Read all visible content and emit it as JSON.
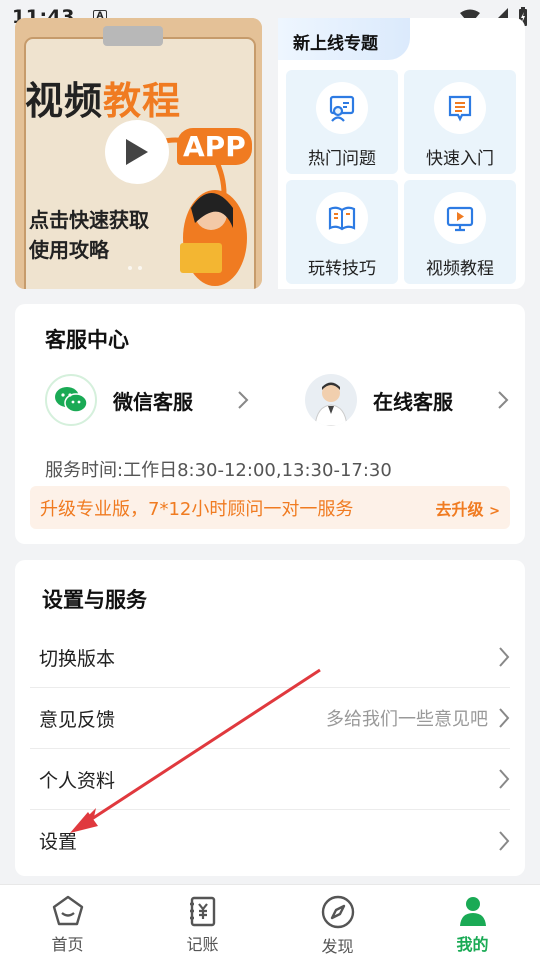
{
  "status_bar": {
    "time": "11:43",
    "notif_glyph": "A"
  },
  "banner": {
    "title_part1": "视频",
    "title_part2": "教程",
    "app_badge": "APP",
    "subtitle_line1": "点击快速获取",
    "subtitle_line2": "使用攻略"
  },
  "promo": {
    "tag": "新上线专题",
    "tiles": [
      {
        "label": "热门问题",
        "icon": "hot-question-icon"
      },
      {
        "label": "快速入门",
        "icon": "quick-start-icon"
      },
      {
        "label": "玩转技巧",
        "icon": "tips-book-icon"
      },
      {
        "label": "视频教程",
        "icon": "video-tutorial-icon"
      }
    ]
  },
  "customer_service": {
    "title": "客服中心",
    "wechat_label": "微信客服",
    "online_label": "在线客服",
    "hours": "服务时间:工作日8:30-12:00,13:30-17:30",
    "upgrade_text": "升级专业版，7*12小时顾问一对一服务",
    "upgrade_link": "去升级",
    "upgrade_link_arrow": ">"
  },
  "settings": {
    "title": "设置与服务",
    "items": [
      {
        "label": "切换版本",
        "hint": ""
      },
      {
        "label": "意见反馈",
        "hint": "多给我们一些意见吧"
      },
      {
        "label": "个人资料",
        "hint": ""
      },
      {
        "label": "设置",
        "hint": ""
      }
    ]
  },
  "tabbar": {
    "tabs": [
      {
        "label": "首页",
        "icon": "home-icon"
      },
      {
        "label": "记账",
        "icon": "ledger-icon"
      },
      {
        "label": "发现",
        "icon": "compass-icon"
      },
      {
        "label": "我的",
        "icon": "profile-icon"
      }
    ],
    "active": "我的"
  },
  "colors": {
    "accent_green": "#1aaa55",
    "accent_orange": "#f07b21",
    "annotation_red": "#e0393e",
    "promo_blue": "#2d7be3"
  }
}
